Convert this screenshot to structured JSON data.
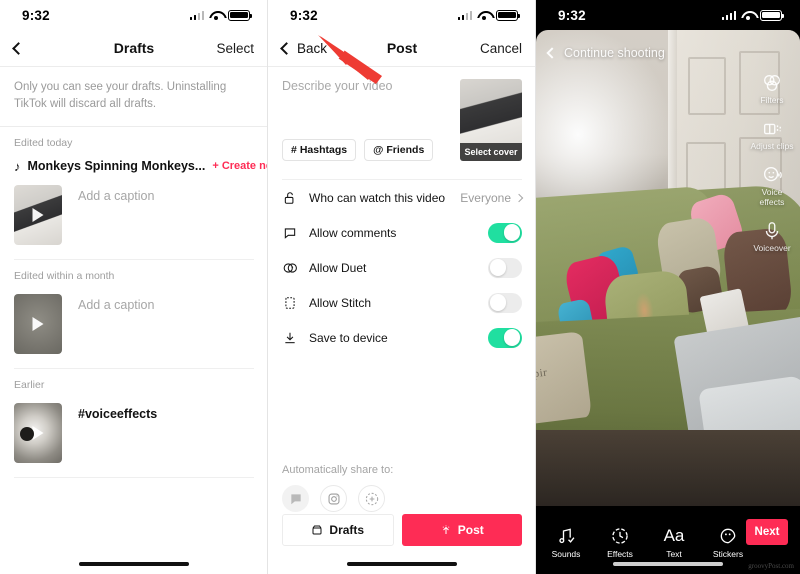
{
  "meta": {
    "watermark": "groovyPost.com"
  },
  "status_bar": {
    "time": "9:32",
    "signal_icon": "signal-bars-icon",
    "wifi_icon": "wifi-icon",
    "battery_icon": "battery-icon"
  },
  "drafts_screen": {
    "nav": {
      "back_icon": "chevron-left-icon",
      "title": "Drafts",
      "right_action": "Select"
    },
    "notice": "Only you can see your drafts. Uninstalling TikTok will discard all drafts.",
    "sections": [
      {
        "label": "Edited today",
        "music": {
          "icon": "music-note-icon",
          "title": "Monkeys Spinning Monkeys...",
          "create_new": "Create new video",
          "create_new_plus": "+"
        },
        "items": [
          {
            "thumb": "desk-keyboard-thumbnail",
            "play_icon": "play-icon",
            "caption": "Add a caption",
            "caption_is_placeholder": true
          }
        ]
      },
      {
        "label": "Edited within a month",
        "items": [
          {
            "thumb": "grey-video-thumbnail",
            "play_icon": "play-icon",
            "caption": "Add a caption",
            "caption_is_placeholder": true
          }
        ]
      },
      {
        "label": "Earlier",
        "items": [
          {
            "thumb": "cat-video-thumbnail",
            "play_icon": "play-icon",
            "caption": "#voiceeffects",
            "caption_is_placeholder": false
          }
        ]
      }
    ]
  },
  "post_screen": {
    "nav": {
      "back_icon": "chevron-left-icon",
      "back_label": "Back",
      "title": "Post",
      "right_action": "Cancel"
    },
    "description_placeholder": "Describe your video",
    "chips": [
      {
        "icon": "hashtag-icon",
        "glyph": "#",
        "label": "Hashtags"
      },
      {
        "icon": "at-mention-icon",
        "glyph": "@",
        "label": "Friends"
      }
    ],
    "cover": {
      "thumb": "desk-keyboard-cover",
      "label": "Select cover"
    },
    "options": [
      {
        "icon": "lock-open-icon",
        "label": "Who can watch this video",
        "control": "value",
        "value": "Everyone",
        "chevron": "chevron-right-icon"
      },
      {
        "icon": "comment-bubble-icon",
        "label": "Allow comments",
        "control": "toggle",
        "state": "on"
      },
      {
        "icon": "duet-icon",
        "label": "Allow Duet",
        "control": "toggle",
        "state": "off"
      },
      {
        "icon": "stitch-icon",
        "label": "Allow Stitch",
        "control": "toggle",
        "state": "off"
      },
      {
        "icon": "download-icon",
        "label": "Save to device",
        "control": "toggle",
        "state": "on"
      }
    ],
    "share": {
      "label": "Automatically share to:",
      "buttons": [
        {
          "icon": "chat-bubble-icon",
          "name": "share-messages"
        },
        {
          "icon": "instagram-icon",
          "name": "share-instagram"
        },
        {
          "icon": "more-plus-icon",
          "name": "share-more"
        }
      ]
    },
    "actions": [
      {
        "icon": "drafts-box-icon",
        "label": "Drafts",
        "style": "outline"
      },
      {
        "icon": "sparkle-icon",
        "label": "Post",
        "style": "primary"
      }
    ]
  },
  "camera_screen": {
    "top": {
      "back_icon": "chevron-left-icon",
      "label": "Continue shooting"
    },
    "side_tools": [
      {
        "icon": "filters-icon",
        "label": "Filters"
      },
      {
        "icon": "adjust-clips-icon",
        "label": "Adjust clips"
      },
      {
        "icon": "voice-effects-icon",
        "label": "Voice effects"
      },
      {
        "icon": "voiceover-microphone-icon",
        "label": "Voiceover"
      }
    ],
    "bottom_tools": [
      {
        "icon": "sounds-music-icon",
        "label": "Sounds"
      },
      {
        "icon": "effects-timer-icon",
        "label": "Effects"
      },
      {
        "icon": "text-aa-icon",
        "label": "Text"
      },
      {
        "icon": "stickers-icon",
        "label": "Stickers"
      }
    ],
    "next_button": "Next",
    "preview_description": "Green couch with colorful pillows in a living room"
  },
  "annotation": {
    "type": "red-arrow",
    "points_to": "Back",
    "color": "#ee3b33"
  },
  "colors": {
    "accent_red": "#fe2c55",
    "toggle_green": "#20dfa0",
    "arrow_red": "#ee3b33"
  }
}
